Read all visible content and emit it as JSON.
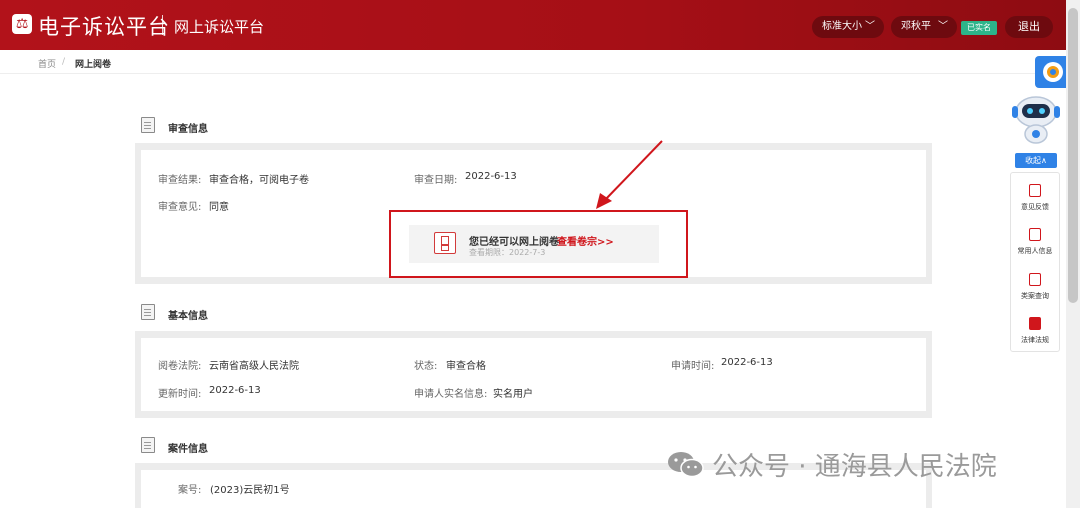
{
  "header": {
    "logo_glyph": "⚖",
    "brand": "电子诉讼平台",
    "subtitle": "网上诉讼平台",
    "font_size_select": "标准大小",
    "user_name": "邓秋平",
    "verified_badge": "已实名",
    "logout_label": "退出",
    "chevron": "﹀"
  },
  "breadcrumb": {
    "home": "首页",
    "sep": "/",
    "current": "网上阅卷"
  },
  "review": {
    "section_title": "审查信息",
    "result_label": "审查结果:",
    "result_value": "审查合格，可阅电子卷",
    "date_label": "审查日期:",
    "date_value": "2022-6-13",
    "opinion_label": "审查意见:",
    "opinion_value": "同意"
  },
  "notice": {
    "text": "您已经可以网上阅卷",
    "link": "查看卷宗>>",
    "sub": "查看期限：2022-7-3"
  },
  "basic": {
    "section_title": "基本信息",
    "court_label": "阅卷法院:",
    "court_value": "云南省高级人民法院",
    "status_label": "状态:",
    "status_value": "审查合格",
    "apply_label": "申请时间:",
    "apply_value": "2022-6-13",
    "update_label": "更新时间:",
    "update_value": "2022-6-13",
    "applicant_label": "申请人实名信息:",
    "applicant_value": "实名用户"
  },
  "case": {
    "section_title": "案件信息",
    "no_label": "案号:",
    "no_value": "(2023)云民初1号"
  },
  "sidebar": {
    "collapse_label": "收起∧",
    "items": [
      {
        "label": "意见反馈",
        "icon": "feedback-icon"
      },
      {
        "label": "常用人信息",
        "icon": "contacts-icon"
      },
      {
        "label": "类案查询",
        "icon": "case-search-icon"
      },
      {
        "label": "法律法规",
        "icon": "law-book-icon"
      }
    ]
  },
  "watermark": {
    "text": "公众号 · 通海县人民法院"
  },
  "colors": {
    "brand_red": "#b2121a",
    "accent_blue": "#2f82e6",
    "badge_green": "#2db48a"
  }
}
